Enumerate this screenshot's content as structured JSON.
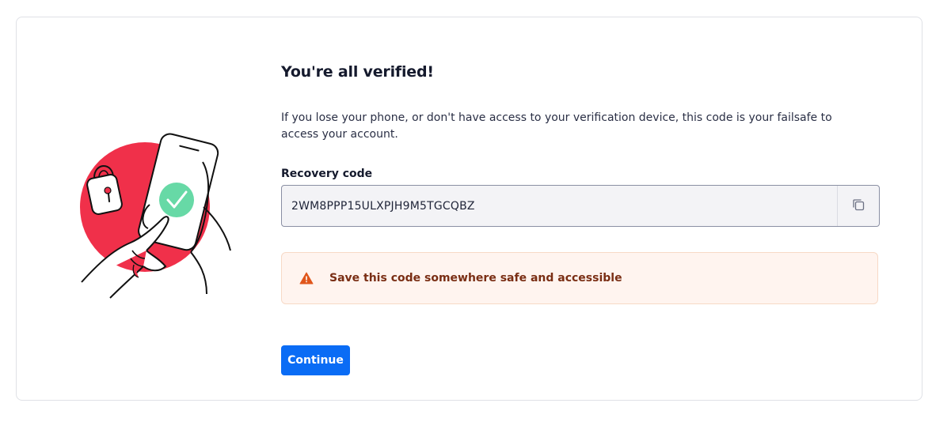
{
  "verification": {
    "title": "You're all verified!",
    "description": "If you lose your phone, or don't have access to your verification device, this code is your failsafe to access your account.",
    "recovery_label": "Recovery code",
    "recovery_code": "2WM8PPP15ULXPJH9M5TGCQBZ",
    "copy_icon": "copy-icon",
    "warning_icon": "warning-icon",
    "warning_text": "Save this code somewhere safe and accessible",
    "continue_label": "Continue"
  },
  "colors": {
    "primary": "#0a6cf5",
    "illustration_red": "#f0304a",
    "check_green": "#67d9a6",
    "warning_orange": "#e0561b",
    "warning_bg": "#fff4ef"
  }
}
